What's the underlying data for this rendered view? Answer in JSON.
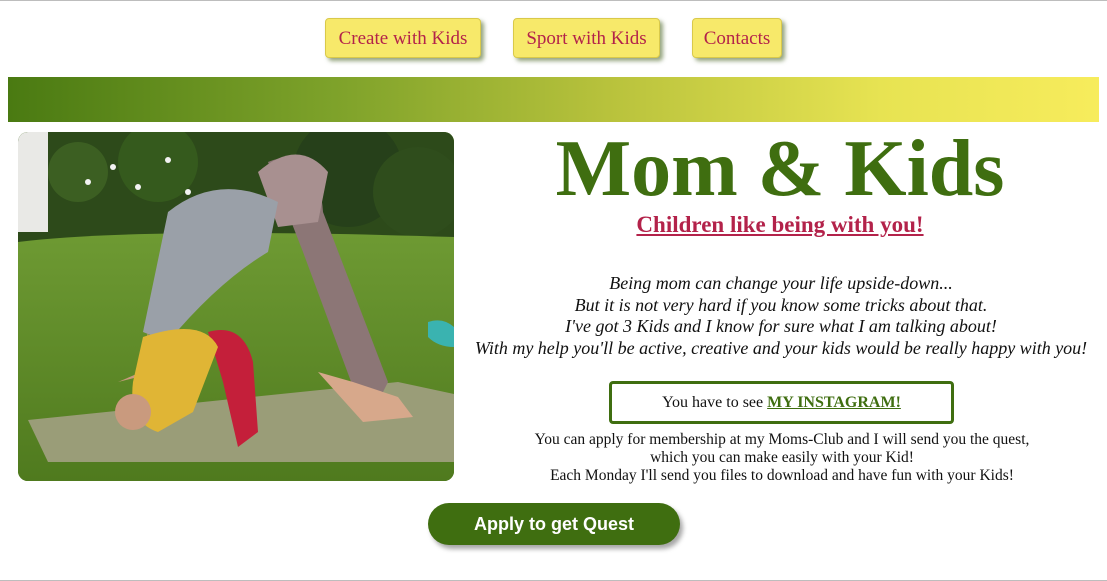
{
  "nav": {
    "items": [
      {
        "label": "Create with Kids"
      },
      {
        "label": "Sport with Kids"
      },
      {
        "label": "Contacts"
      }
    ]
  },
  "hero": {
    "title": "Mom & Kids",
    "subtitle": "Children like being with you!",
    "intro_lines": [
      "Being mom can change your life upside-down...",
      "But it is not very hard if you know some tricks about that.",
      "I've got 3 Kids and I know for sure what I am talking about!",
      "With my help you'll be active, creative and your kids would be really happy with you!"
    ]
  },
  "instagram": {
    "prefix": "You have to see",
    "link_label": "MY INSTAGRAM!"
  },
  "membership": {
    "lines": [
      "You can apply for membership at my Moms-Club and I will send you the quest,",
      "which you can make easily with your Kid!",
      "Each Monday I'll send you files to download and have fun with your Kids!"
    ]
  },
  "cta": {
    "label": "Apply to get Quest"
  },
  "colors": {
    "brand_green": "#3f6e10",
    "accent_red": "#b3224a",
    "nav_yellow": "#f7e96a"
  }
}
